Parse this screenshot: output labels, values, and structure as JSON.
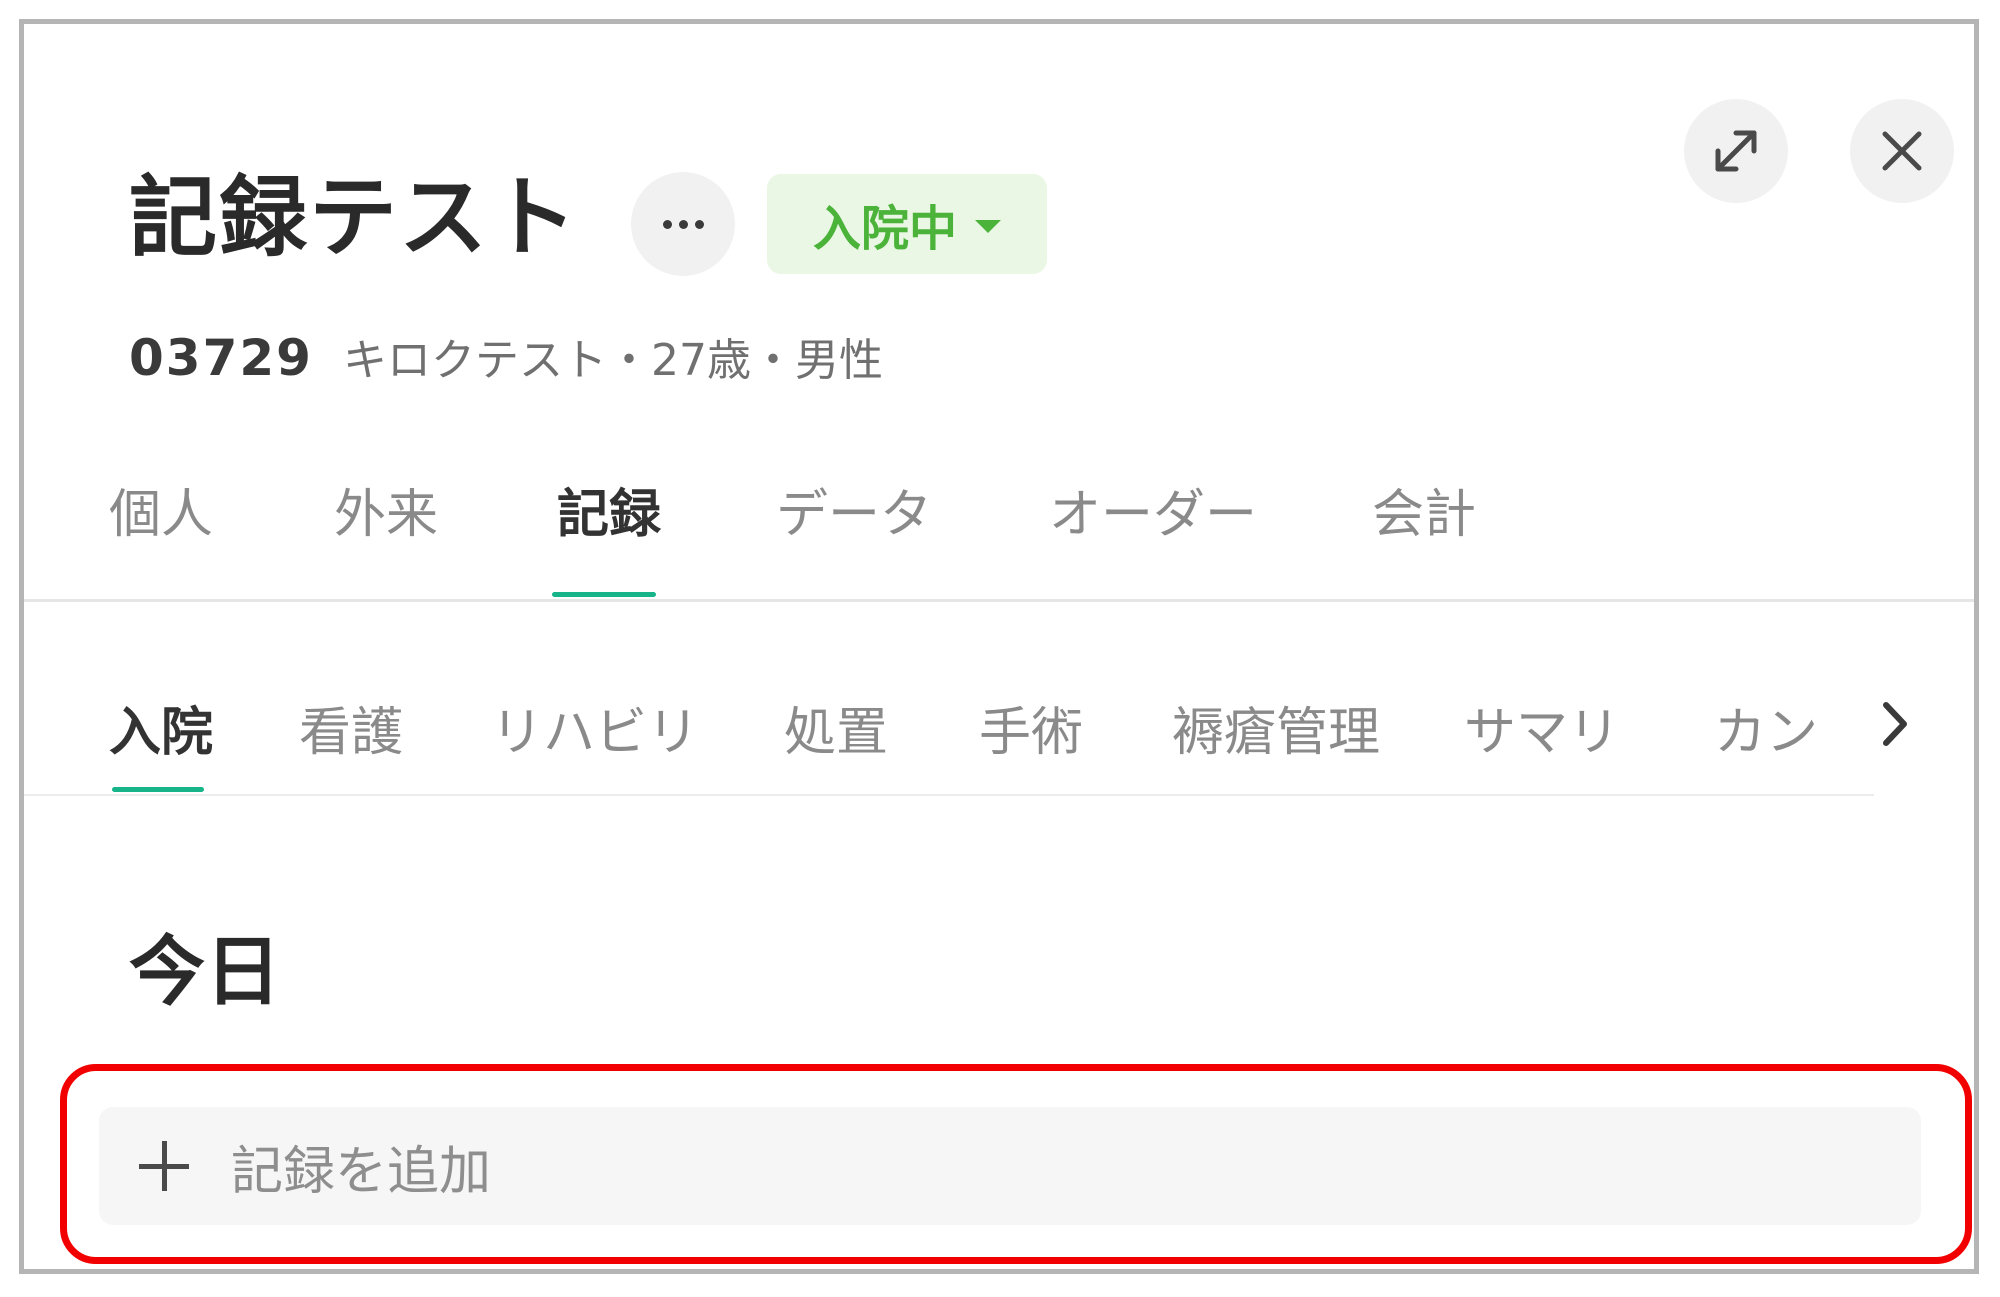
{
  "patient": {
    "name": "記録テスト",
    "id": "03729",
    "info": "キロクテスト・27歳・男性"
  },
  "status": {
    "label": "入院中",
    "color": "#4bb33a"
  },
  "header": {
    "more_icon": "more-dots-icon",
    "expand_icon": "expand-icon",
    "close_icon": "close-icon"
  },
  "main_tabs": [
    {
      "label": "個人"
    },
    {
      "label": "外来"
    },
    {
      "label": "記録"
    },
    {
      "label": "データ"
    },
    {
      "label": "オーダー"
    },
    {
      "label": "会計"
    }
  ],
  "main_tabs_active": "記録",
  "sub_tabs": [
    {
      "label": "入院"
    },
    {
      "label": "看護"
    },
    {
      "label": "リハビリ"
    },
    {
      "label": "処置"
    },
    {
      "label": "手術"
    },
    {
      "label": "褥瘡管理"
    },
    {
      "label": "サマリ"
    },
    {
      "label": "カン"
    }
  ],
  "sub_tabs_active": "入院",
  "section": {
    "heading": "今日"
  },
  "add_record": {
    "label": "記録を追加",
    "icon": "plus-icon"
  },
  "colors": {
    "accent": "#17b389",
    "highlight": "#f20000",
    "status_bg": "#e9f7e4"
  }
}
